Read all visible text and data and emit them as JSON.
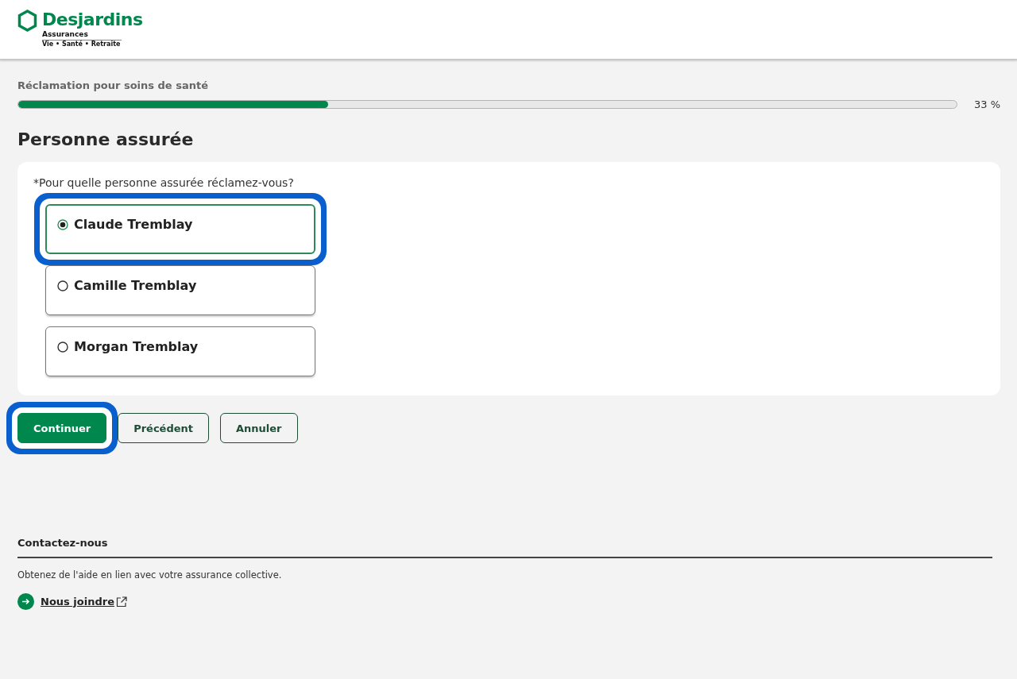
{
  "header": {
    "brand": "Desjardins",
    "subbrand": "Assurances",
    "tagline": "Vie • Santé • Retraite"
  },
  "progress": {
    "label": "Réclamation pour soins de santé",
    "level": 0.33,
    "reading": "33 %"
  },
  "title": "Personne assurée",
  "question": {
    "required_mark": "*",
    "text": "Pour quelle personne assurée réclamez-vous?"
  },
  "options": [
    {
      "label": "Claude Tremblay",
      "selected": true,
      "highlighted": true
    },
    {
      "label": "Camille Tremblay",
      "selected": false,
      "highlighted": false
    },
    {
      "label": "Morgan Tremblay",
      "selected": false,
      "highlighted": false
    }
  ],
  "buttons": [
    {
      "label": "Continuer",
      "kind": "primary",
      "highlighted": true
    },
    {
      "label": "Précédent",
      "kind": "secondary",
      "highlighted": false
    },
    {
      "label": "Annuler",
      "kind": "secondary",
      "highlighted": false
    }
  ],
  "footer": {
    "title": "Contactez-nous",
    "text": "Obtenez de l'aide en lien avec votre assurance collective.",
    "link": "Nous joindre"
  }
}
